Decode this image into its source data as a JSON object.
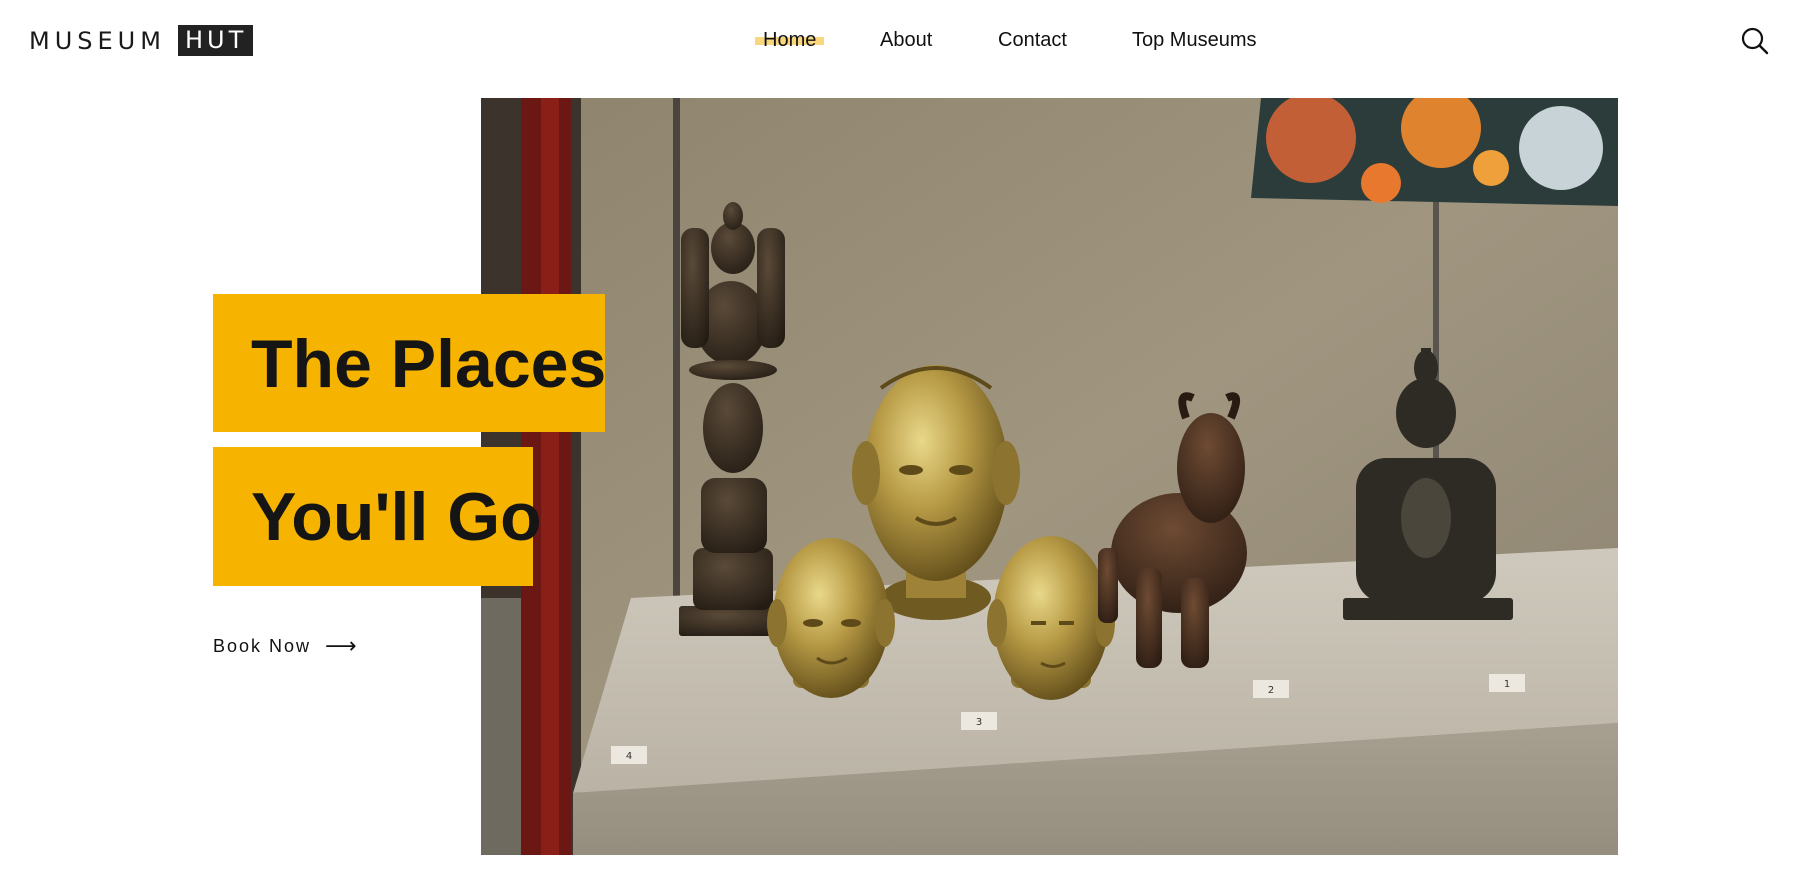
{
  "header": {
    "logo_word": "MUSEUM",
    "logo_box": "HUT",
    "nav": [
      {
        "label": "Home",
        "active": true
      },
      {
        "label": "About"
      },
      {
        "label": "Contact"
      },
      {
        "label": "Top Museums"
      }
    ],
    "search_icon": "search-icon"
  },
  "hero": {
    "image_alt": "museum display case with bronze statues and figurines",
    "headline_line1": "The Places",
    "headline_line2": "You'll Go",
    "cta_label": "Book Now",
    "cta_icon": "arrow-right-icon",
    "cta_arrow": "⟶",
    "label_tags": [
      "4",
      "3",
      "2",
      "1"
    ]
  },
  "colors": {
    "accent": "#f6b400",
    "nav_highlight": "#f5c954",
    "text": "#111111",
    "logo_box_bg": "#222222"
  }
}
